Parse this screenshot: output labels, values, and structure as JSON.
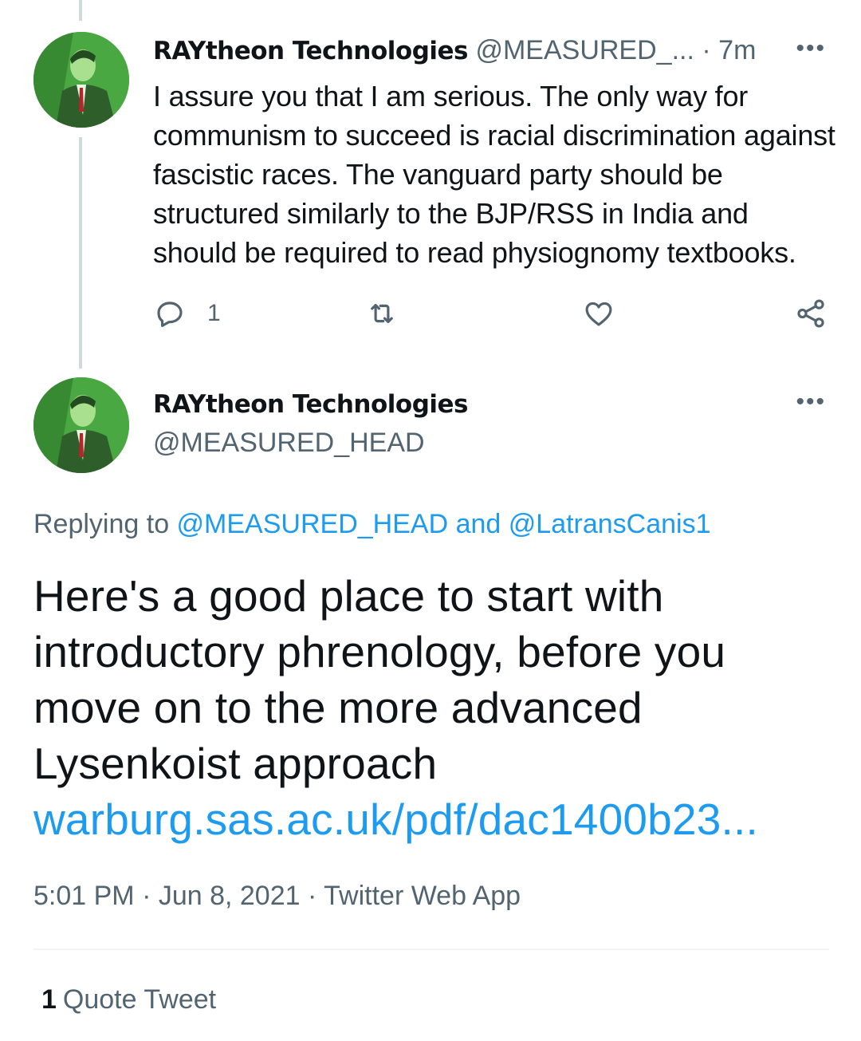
{
  "tweet1": {
    "display_name": "RAYtheon Technologies",
    "handle": "@MEASURED_...",
    "separator": "·",
    "time": "7m",
    "more_label": "•••",
    "text": "I assure you that I am serious. The only way for communism to succeed is racial discrimination against fascistic races. The vanguard party should be structured similarly to the BJP/RSS in India and should be required to read physiognomy textbooks.",
    "reply_count": "1",
    "icons": [
      "reply-icon",
      "retweet-icon",
      "like-icon",
      "share-icon"
    ]
  },
  "tweet2": {
    "display_name": "RAYtheon Technologies",
    "handle": "@MEASURED_HEAD",
    "more_label": "•••",
    "replying_prefix": "Replying to ",
    "replying_user1": "@MEASURED_HEAD",
    "replying_and": " and ",
    "replying_user2": "@LatransCanis1",
    "text": "Here's a good place to start with introductory phrenology, before you move on to the more advanced Lysenkoist approach",
    "link": "warburg.sas.ac.uk/pdf/dac1400b23...",
    "timestamp": "5:01 PM · Jun 8, 2021 · Twitter Web App",
    "quote_count": "1",
    "quote_label": "Quote Tweet"
  },
  "colors": {
    "link": "#1d9bf0",
    "secondary_text": "#536471",
    "primary_text": "#0f1419",
    "thread_line": "#cfd9de"
  }
}
